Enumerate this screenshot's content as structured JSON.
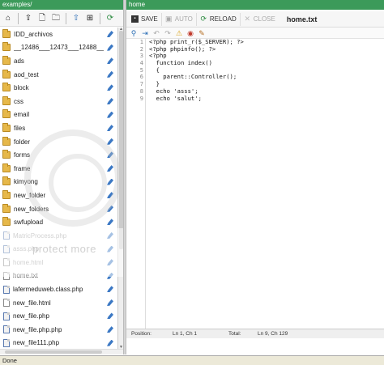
{
  "left_panel": {
    "title": "examples/",
    "toolbar_icons": [
      "home-icon",
      "upload-file-icon",
      "new-file-icon",
      "new-folder-icon",
      "up-directory-icon",
      "download-icon",
      "refresh-icon"
    ],
    "files": [
      {
        "name": "IDD_archivos",
        "type": "folder"
      },
      {
        "name": "__12486___12473___12488__",
        "type": "folder"
      },
      {
        "name": "ads",
        "type": "folder"
      },
      {
        "name": "aod_test",
        "type": "folder"
      },
      {
        "name": "block",
        "type": "folder"
      },
      {
        "name": "css",
        "type": "folder"
      },
      {
        "name": "email",
        "type": "folder"
      },
      {
        "name": "files",
        "type": "folder"
      },
      {
        "name": "folder",
        "type": "folder"
      },
      {
        "name": "forms",
        "type": "folder"
      },
      {
        "name": "frame",
        "type": "folder"
      },
      {
        "name": "kimyong",
        "type": "folder"
      },
      {
        "name": "new_folder",
        "type": "folder"
      },
      {
        "name": "new_folders",
        "type": "folder"
      },
      {
        "name": "swfupload",
        "type": "folder"
      },
      {
        "name": "MatricProcess.php",
        "type": "php",
        "dim": true
      },
      {
        "name": "asss.php",
        "type": "php",
        "dim": true
      },
      {
        "name": "home.html",
        "type": "file",
        "dim": true
      },
      {
        "name": "home.txt",
        "type": "file"
      },
      {
        "name": "lafermeduweb.class.php",
        "type": "php"
      },
      {
        "name": "new_file.html",
        "type": "file"
      },
      {
        "name": "new_file.php",
        "type": "php"
      },
      {
        "name": "new_file.php.php",
        "type": "php"
      },
      {
        "name": "new_file111.php",
        "type": "php"
      }
    ],
    "watermark_text": "protect more"
  },
  "editor": {
    "title": "home",
    "toolbar": {
      "save_label": "SAVE",
      "auto_label": "AUTO",
      "reload_label": "RELOAD",
      "close_label": "CLOSE"
    },
    "filename": "home.txt",
    "toolbar2_icons": [
      "search-icon",
      "goto-icon",
      "undo-icon",
      "redo-icon",
      "warning-icon",
      "color-picker-icon",
      "brush-icon"
    ],
    "line_numbers": [
      "1",
      "2",
      "3",
      "4",
      "5",
      "6",
      "7",
      "8",
      "9"
    ],
    "code_lines": [
      "<?php print_r($_SERVER); ?>",
      "<?php phpinfo(); ?>",
      "<?php",
      "  function index()",
      "  {",
      "    parent::Controller();",
      "  }",
      "  echo 'asss';",
      "  echo 'salut';"
    ],
    "status": {
      "position_label": "Position:",
      "position_value": "Ln 1, Ch 1",
      "total_label": "Total:",
      "total_value": "Ln 9, Ch 129"
    }
  },
  "browser_status": "Done",
  "colors": {
    "title_bar": "#3c9a5a",
    "edit_icon": "#3b78c4",
    "folder": "#e6b84a"
  }
}
